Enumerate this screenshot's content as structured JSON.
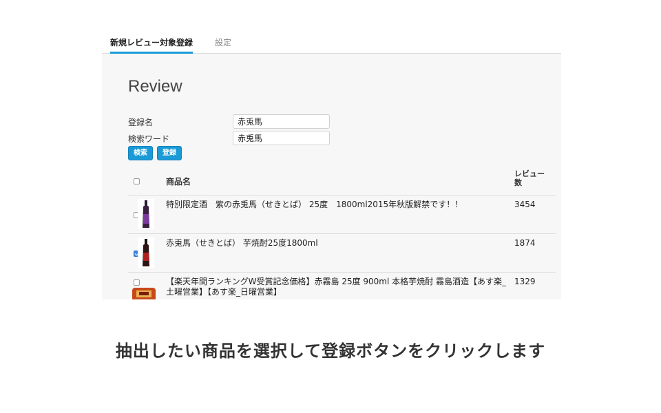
{
  "tabs": [
    {
      "label": "新規レビュー対象登録"
    },
    {
      "label": "設定"
    }
  ],
  "main": {
    "title": "Review",
    "form": {
      "name_label": "登録名",
      "name_value": "赤兎馬",
      "keyword_label": "検索ワード",
      "keyword_value": "赤兎馬"
    },
    "buttons": {
      "search": "検索",
      "register": "登録"
    },
    "table": {
      "headers": {
        "name": "商品名",
        "count": "レビュー数"
      },
      "rows": [
        {
          "name": "特別限定酒　紫の赤兎馬（せきとば） 25度　1800ml2015年秋版解禁です！！",
          "count": "3454",
          "checked": false
        },
        {
          "name": "赤兎馬（せきとば） 芋焼酎25度1800ml",
          "count": "1874",
          "checked": true
        },
        {
          "name": "【楽天年間ランキングW受賞記念価格】赤霧島 25度 900ml 本格芋焼酎 霧島酒造【あす楽_土曜営業】【あす楽_日曜営業】",
          "count": "1329",
          "checked": false
        }
      ]
    }
  },
  "caption": "抽出したい商品を選択して登録ボタンをクリックします",
  "colors": {
    "accent": "#1a9ad6",
    "panel_bg": "#f7f7f7"
  }
}
